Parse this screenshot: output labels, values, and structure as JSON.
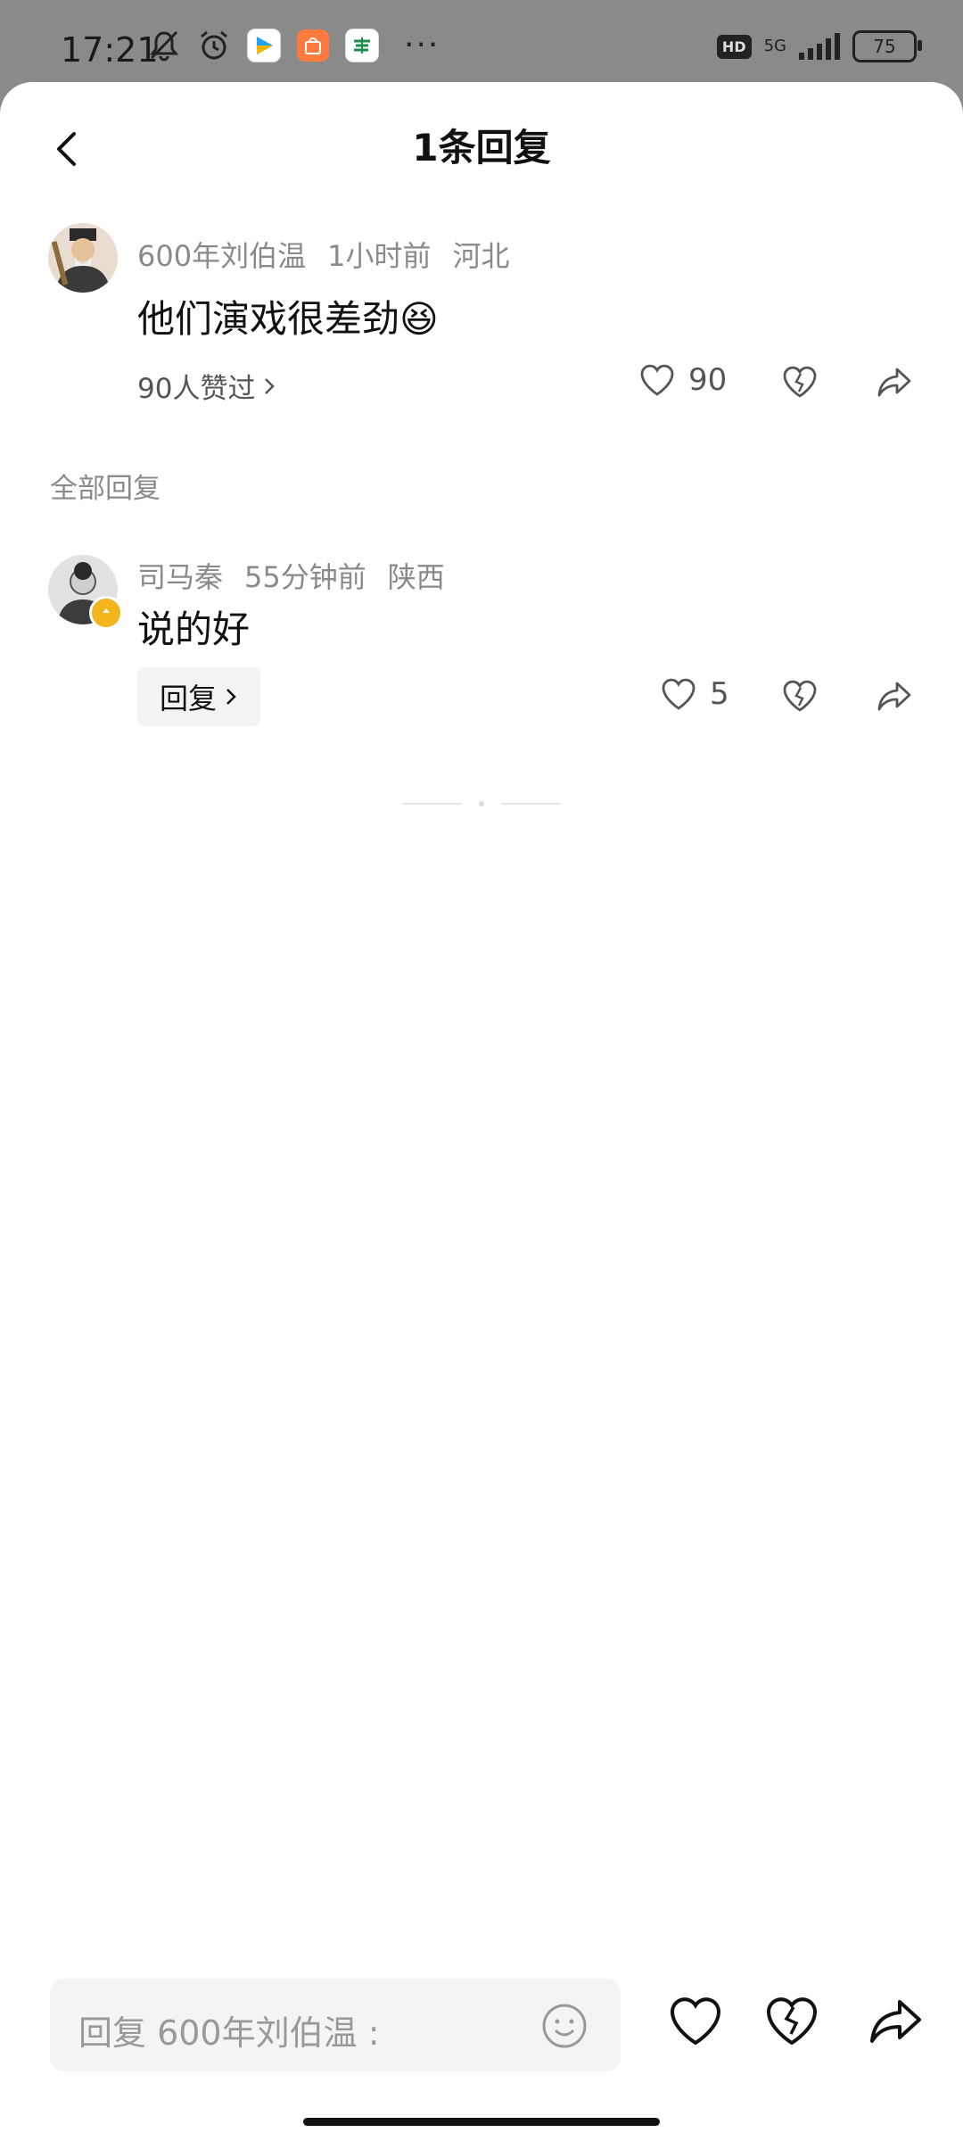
{
  "status_bar": {
    "time": "17:21",
    "icons": [
      "mute-bell-icon",
      "alarm-icon",
      "video-app-icon",
      "shopping-app-icon",
      "post-app-icon"
    ],
    "overflow": "···",
    "hd": "HD",
    "network": "5G",
    "battery": "75"
  },
  "header": {
    "title": "1条回复",
    "back_icon": "back-chevron-icon"
  },
  "comment": {
    "author": "600年刘伯温",
    "time": "1小时前",
    "location": "河北",
    "text": "他们演戏很差劲",
    "emoji": "😆",
    "liked_by": "90人赞过",
    "like_count": "90"
  },
  "section": {
    "label": "全部回复"
  },
  "reply": {
    "author": "司马秦",
    "time": "55分钟前",
    "location": "陕西",
    "text": "说的好",
    "reply_button": "回复",
    "like_count": "5"
  },
  "bottom_bar": {
    "placeholder": "回复 600年刘伯温 :",
    "icons": [
      "emoji-icon",
      "like-icon",
      "dislike-icon",
      "share-icon"
    ]
  },
  "colors": {
    "accent_badge": "#f2b51b",
    "secondary_text": "#8a8a8a"
  }
}
